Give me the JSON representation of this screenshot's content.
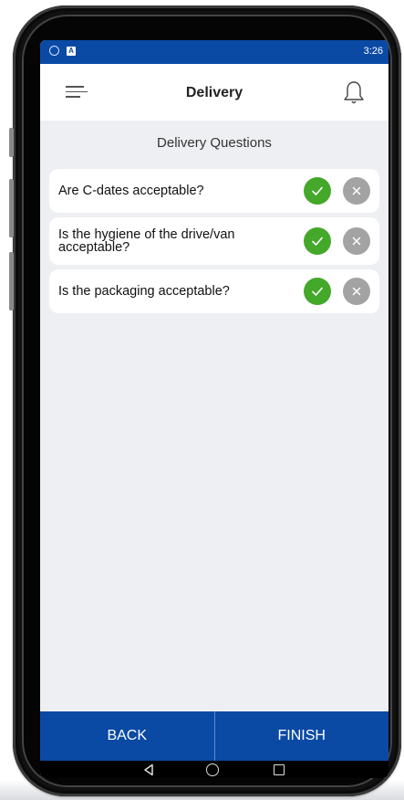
{
  "status_bar": {
    "time": "3:26",
    "icon_letter": "A"
  },
  "header": {
    "title": "Delivery"
  },
  "section": {
    "title": "Delivery Questions"
  },
  "questions": [
    {
      "text": "Are C-dates acceptable?",
      "answer": "yes"
    },
    {
      "text": "Is the hygiene of the drive/van acceptable?",
      "answer": "yes"
    },
    {
      "text": "Is the packaging acceptable?",
      "answer": "yes"
    }
  ],
  "footer": {
    "back_label": "BACK",
    "finish_label": "FINISH"
  },
  "colors": {
    "primary": "#0a4aa5",
    "yes": "#44a82a",
    "no": "#a3a3a3",
    "background": "#eeeff2"
  },
  "icons": {
    "menu": "hamburger-icon",
    "notification": "bell-icon",
    "yes": "checkmark-icon",
    "no": "close-icon"
  }
}
